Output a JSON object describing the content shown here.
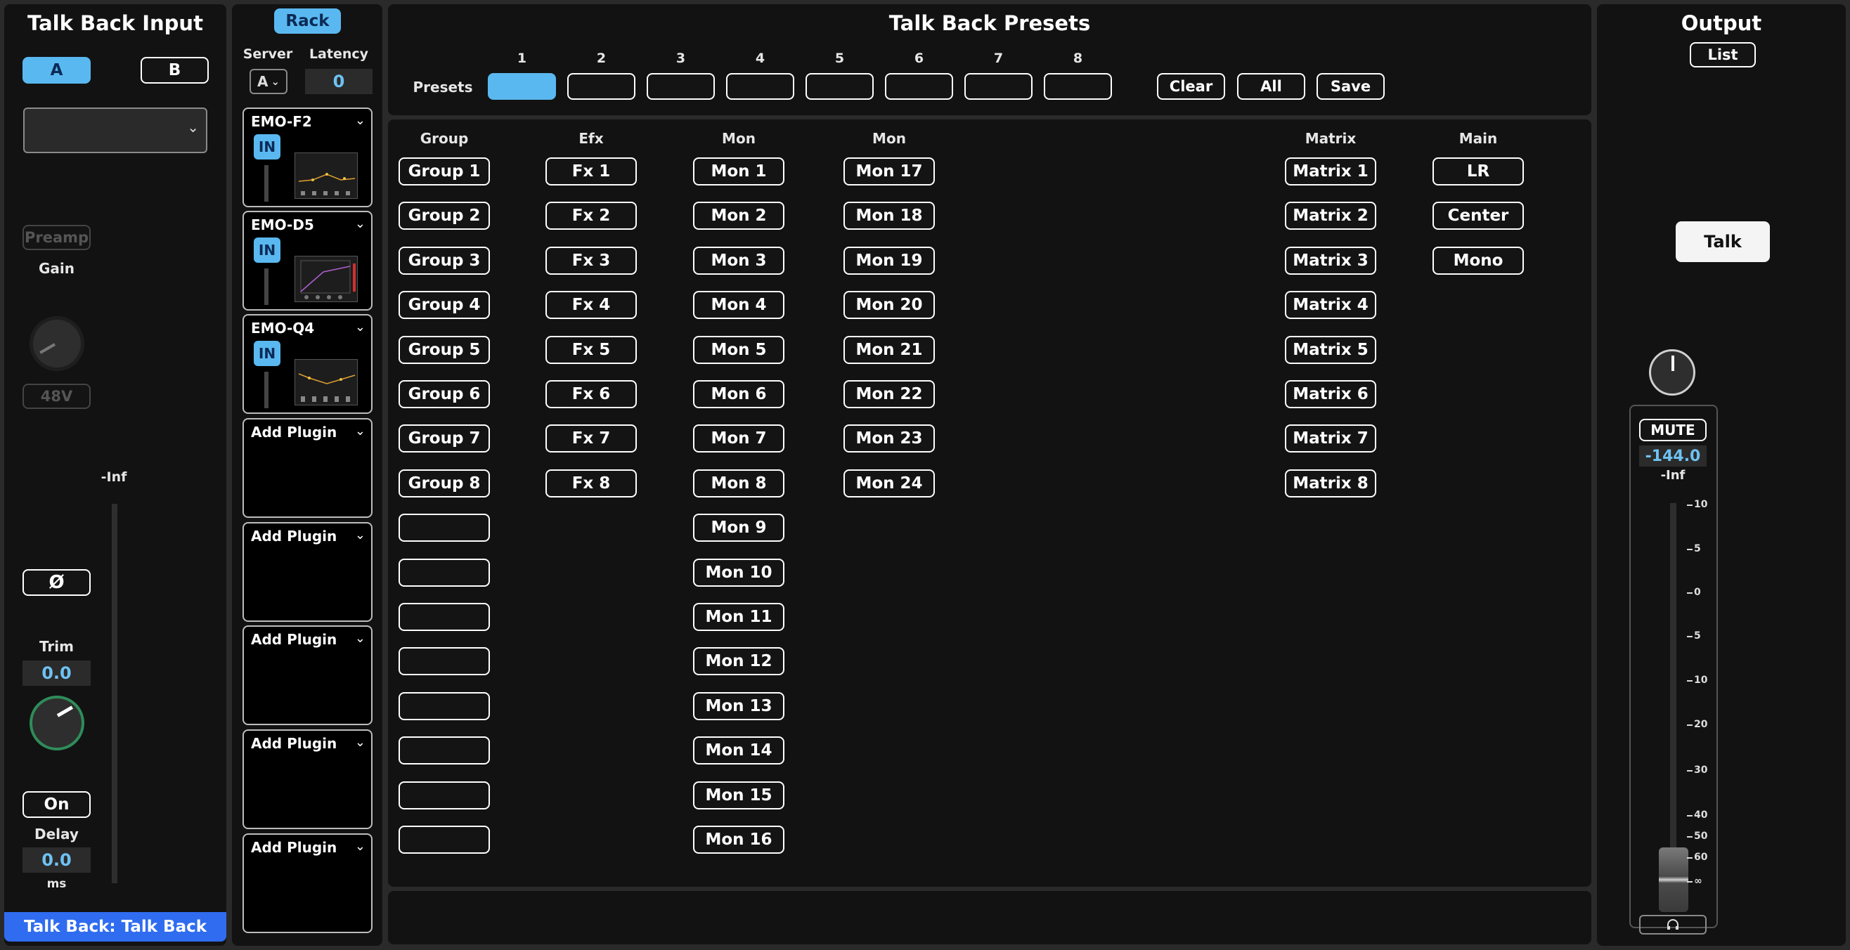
{
  "input": {
    "title": "Talk Back Input",
    "a_label": "A",
    "b_label": "B",
    "preamp_label": "Preamp",
    "gain_label": "Gain",
    "phantom_label": "48V",
    "meter_label": "-Inf",
    "phase_symbol": "Ø",
    "trim_label": "Trim",
    "trim_value": "0.0",
    "on_label": "On",
    "delay_label": "Delay",
    "delay_value": "0.0",
    "delay_unit": "ms",
    "footer": "Talk Back: Talk Back"
  },
  "rack": {
    "rack_label": "Rack",
    "server_label": "Server",
    "server_value": "A",
    "latency_label": "Latency",
    "latency_value": "0",
    "in_label": "IN",
    "plugins": [
      "EMO-F2",
      "EMO-D5",
      "EMO-Q4"
    ],
    "add_plugin_label": "Add Plugin"
  },
  "presets": {
    "title": "Talk Back Presets",
    "row_label": "Presets",
    "numbers": [
      "1",
      "2",
      "3",
      "4",
      "5",
      "6",
      "7",
      "8"
    ],
    "clear_label": "Clear",
    "all_label": "All",
    "save_label": "Save"
  },
  "routing": {
    "group_header": "Group",
    "groups": [
      "Group 1",
      "Group 2",
      "Group 3",
      "Group 4",
      "Group 5",
      "Group 6",
      "Group 7",
      "Group 8"
    ],
    "efx_header": "Efx",
    "fx": [
      "Fx 1",
      "Fx 2",
      "Fx 3",
      "Fx 4",
      "Fx 5",
      "Fx 6",
      "Fx 7",
      "Fx 8"
    ],
    "mon_header": "Mon",
    "mons_a": [
      "Mon 1",
      "Mon 2",
      "Mon 3",
      "Mon 4",
      "Mon 5",
      "Mon 6",
      "Mon 7",
      "Mon 8",
      "Mon 9",
      "Mon 10",
      "Mon 11",
      "Mon 12",
      "Mon 13",
      "Mon 14",
      "Mon 15",
      "Mon 16"
    ],
    "mon2_header": "Mon",
    "mons_b": [
      "Mon 17",
      "Mon 18",
      "Mon 19",
      "Mon 20",
      "Mon 21",
      "Mon 22",
      "Mon 23",
      "Mon 24"
    ],
    "matrix_header": "Matrix",
    "matrices": [
      "Matrix 1",
      "Matrix 2",
      "Matrix 3",
      "Matrix 4",
      "Matrix 5",
      "Matrix 6",
      "Matrix 7",
      "Matrix 8"
    ],
    "main_header": "Main",
    "mains": [
      "LR",
      "Center",
      "Mono"
    ]
  },
  "output": {
    "title": "Output",
    "list_label": "List",
    "talk_label": "Talk",
    "mute_label": "MUTE",
    "level_value": "-144.0",
    "meter_label": "-Inf",
    "scale": [
      "10",
      "5",
      "0",
      "5",
      "10",
      "20",
      "30",
      "40",
      "50",
      "60",
      "∞"
    ],
    "headphone_icon": "headphone-icon"
  },
  "colors": {
    "accent_blue": "#5ab8f0",
    "footer_blue": "#2f6cf0",
    "panel_bg": "#121212",
    "value_text": "#6ec2f2"
  }
}
